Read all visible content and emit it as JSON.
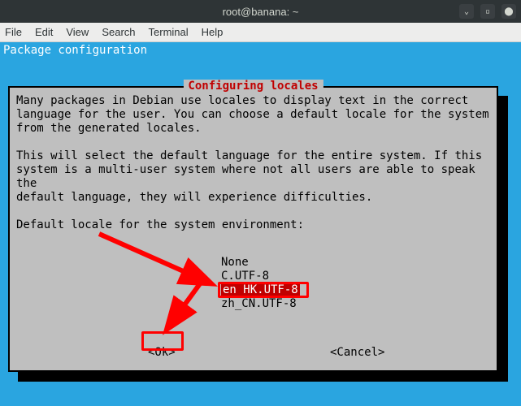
{
  "titlebar": {
    "title": "root@banana: ~"
  },
  "controls": {
    "min": "⌄",
    "max": "▫",
    "close": "⬤"
  },
  "menu": {
    "file": "File",
    "edit": "Edit",
    "view": "View",
    "search": "Search",
    "terminal": "Terminal",
    "help": "Help"
  },
  "header": {
    "package_config": "Package configuration"
  },
  "dialog": {
    "title": "Configuring locales",
    "body": "Many packages in Debian use locales to display text in the correct\nlanguage for the user. You can choose a default locale for the system\nfrom the generated locales.\n\nThis will select the default language for the entire system. If this\nsystem is a multi-user system where not all users are able to speak the\ndefault language, they will experience difficulties.\n\nDefault locale for the system environment:",
    "options": {
      "none": "None",
      "c_utf8": "C.UTF-8",
      "en_hk": "en_HK.UTF-8",
      "zh_cn": "zh_CN.UTF-8"
    },
    "ok": "<Ok>",
    "cancel": "<Cancel>"
  }
}
